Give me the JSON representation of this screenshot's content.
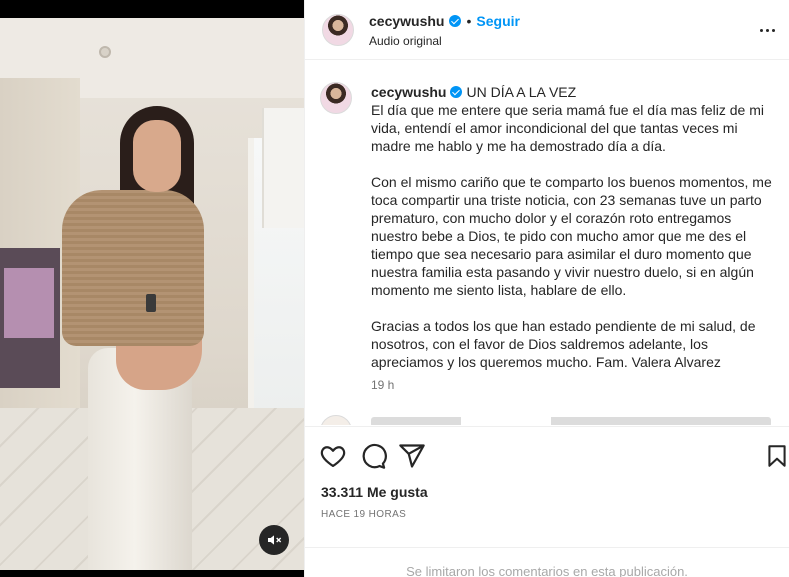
{
  "header": {
    "username": "cecywushu",
    "separator": "•",
    "follow_label": "Seguir",
    "audio_label": "Audio original"
  },
  "caption": {
    "username": "cecywushu",
    "title": "UN DÍA A LA VEZ",
    "paragraph1": "El día que me entere que seria mamá fue el día mas feliz de mi vida, entendí el amor incondicional del que tantas veces mi madre me hablo y me ha demostrado día a día.",
    "paragraph2": "Con el mismo cariño que te comparto los buenos momentos, me toca compartir una triste noticia, con 23 semanas tuve un parto prematuro, con mucho dolor y el corazón roto entregamos nuestro bebe a Dios, te pido con mucho amor que me des el tiempo que sea necesario para asimilar el duro momento que nuestra familia esta pasando y vivir nuestro duelo, si en algún momento me siento lista, hablare de ello.",
    "paragraph3": "Gracias a todos los que han estado pendiente de mi salud, de nosotros, con el favor de Dios saldremos adelante, los apreciamos y los queremos mucho. Fam. Valera Alvarez",
    "time_ago": "19 h"
  },
  "actions": {
    "likes": "33.311 Me gusta",
    "posted": "HACE 19 HORAS",
    "comments_disabled": "Se limitaron los comentarios en esta publicación."
  },
  "icons": {
    "like": "heart-icon",
    "comment": "comment-icon",
    "share": "share-icon",
    "save": "bookmark-icon",
    "mute": "speaker-muted-icon",
    "more": "more-options-icon",
    "verified": "verified-badge-icon"
  },
  "colors": {
    "accent": "#0095f6",
    "text": "#262626",
    "muted": "#737373",
    "border": "#efefef"
  }
}
